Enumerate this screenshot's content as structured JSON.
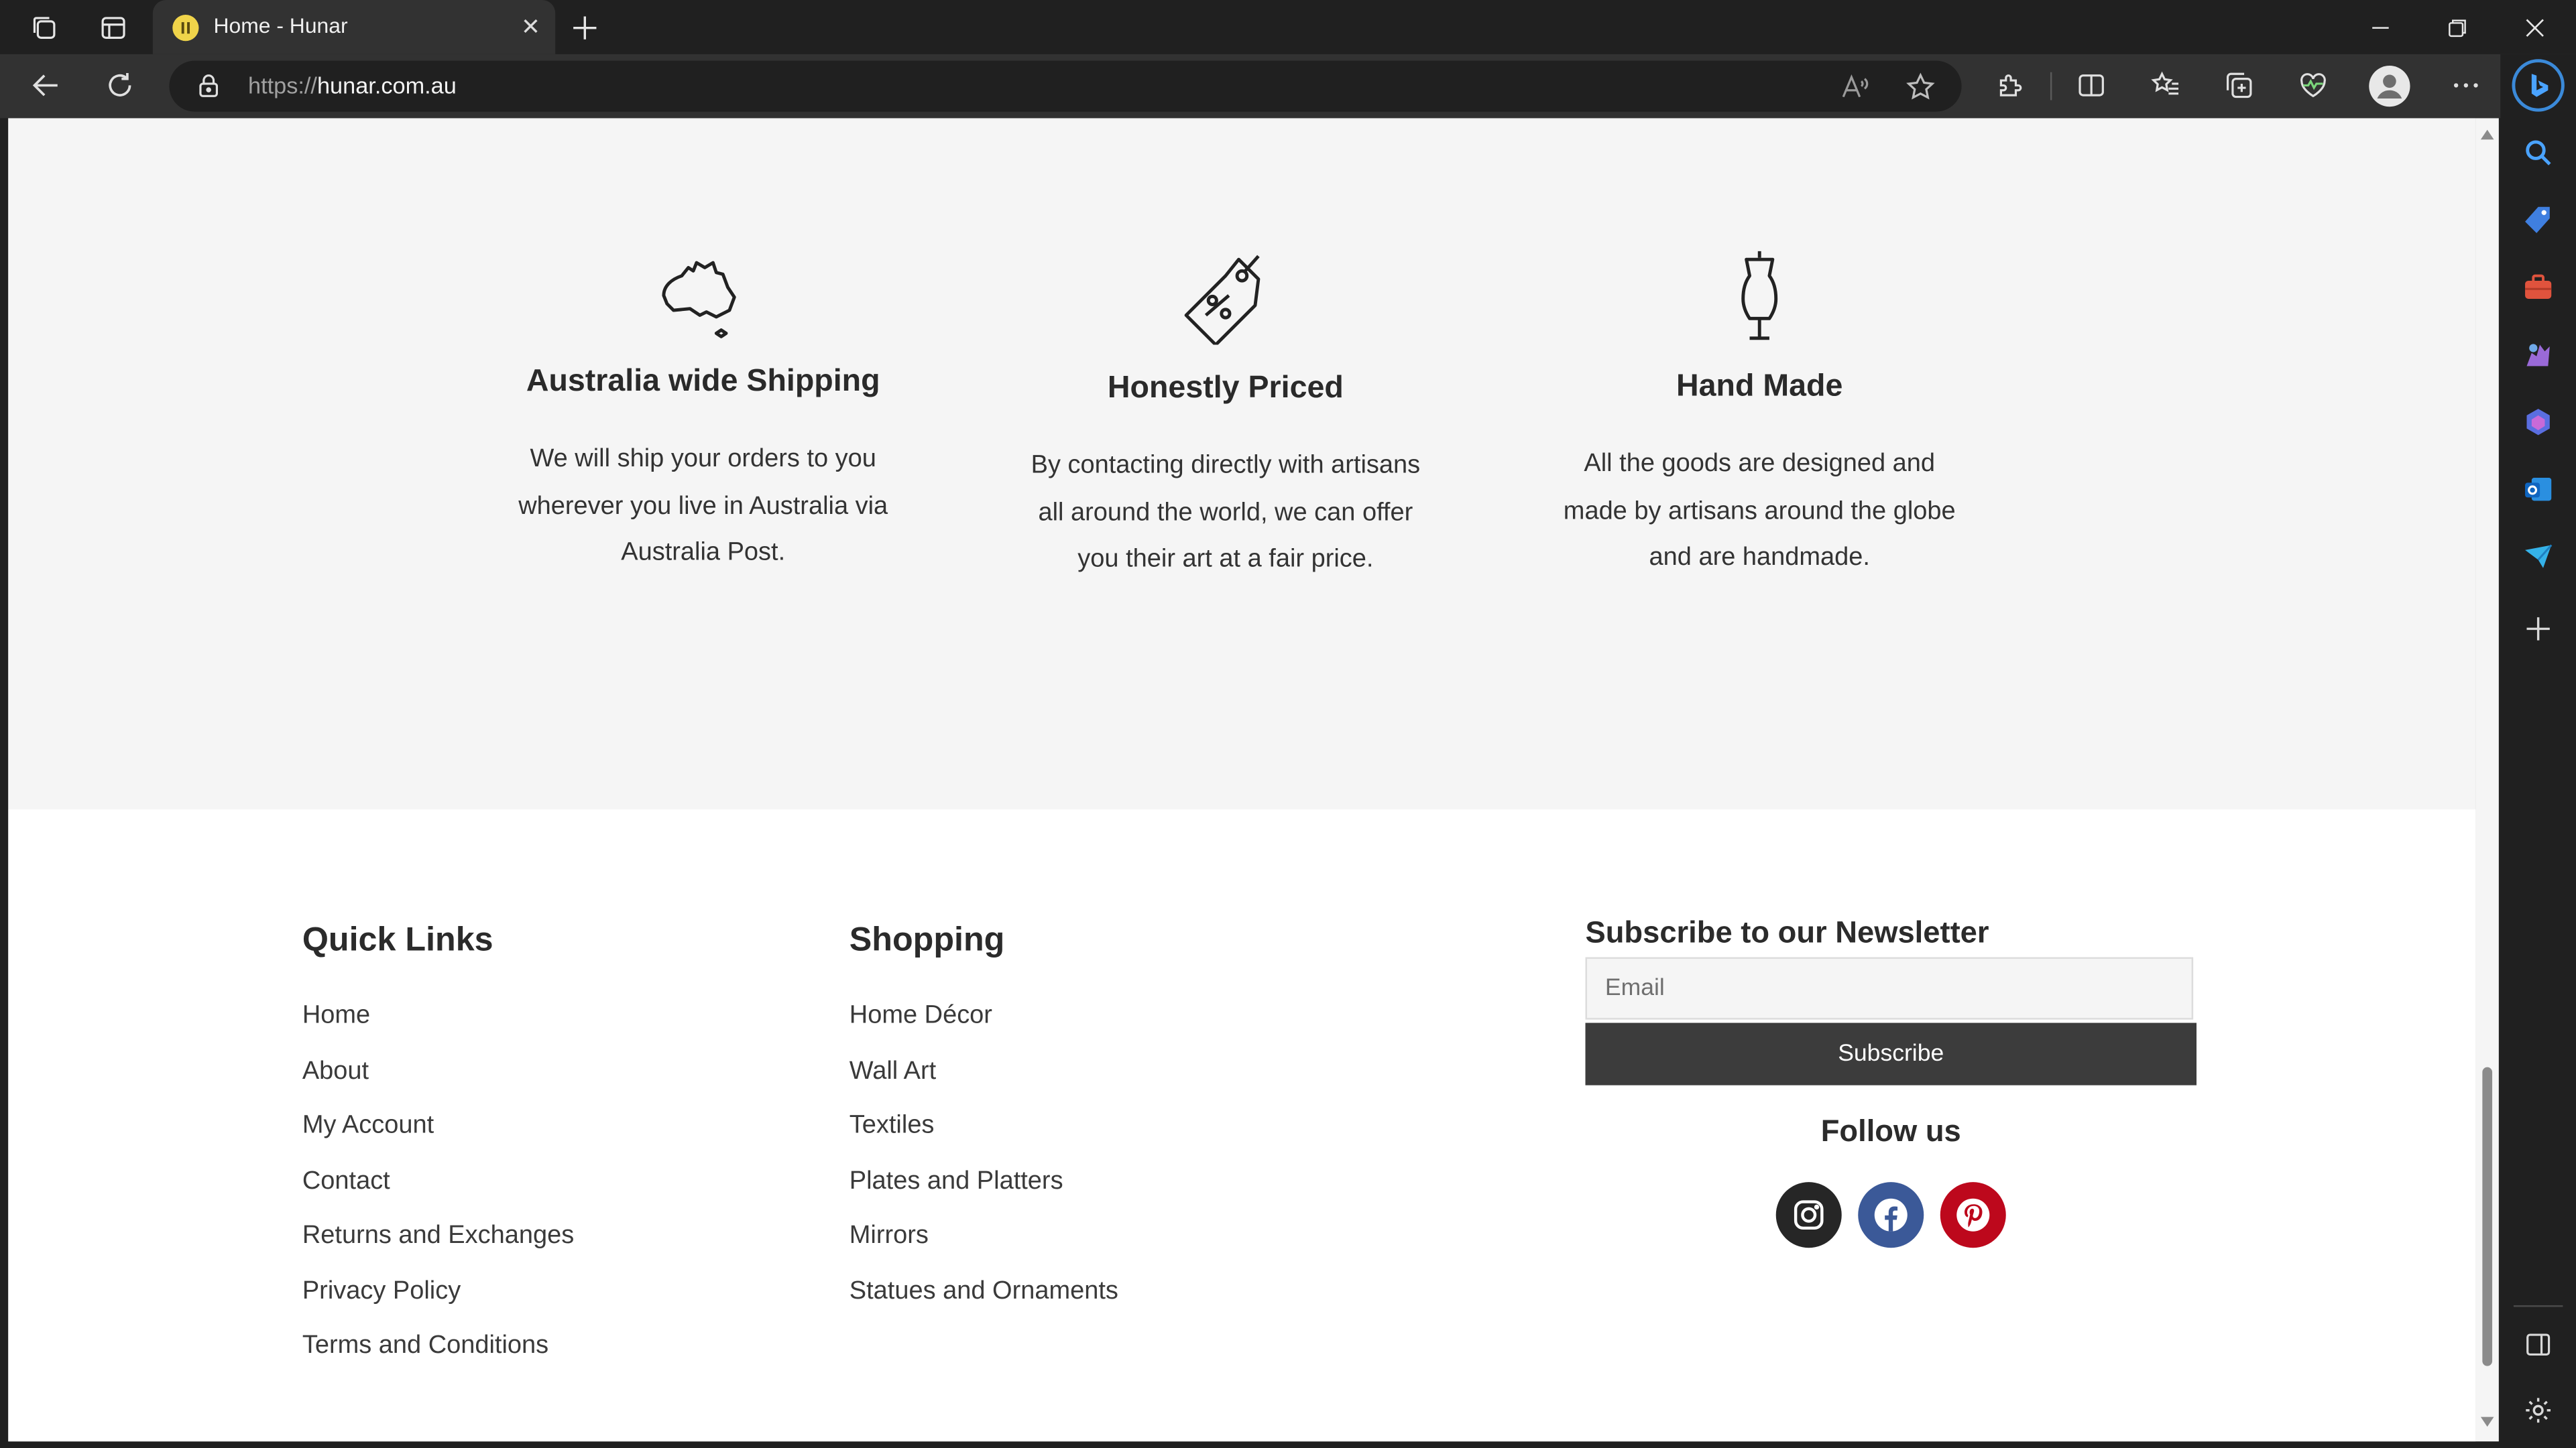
{
  "browser": {
    "tab_title": "Home - Hunar",
    "url_protocol": "https://",
    "url_host": "hunar.com.au"
  },
  "icons": {
    "workspaces": "workspaces-icon",
    "tab_actions": "tab-actions-icon",
    "back": "back-arrow-icon",
    "refresh": "refresh-icon",
    "lock": "lock-icon",
    "read_aloud": "read-aloud-icon",
    "favorite": "star-icon",
    "extensions": "puzzle-icon",
    "split_screen": "split-screen-icon",
    "favorites": "favorites-list-icon",
    "collections": "collections-icon",
    "performance": "heartbeat-icon",
    "profile": "profile-icon",
    "more": "more-icon",
    "copilot": "bing-icon"
  },
  "features": [
    {
      "icon": "australia-map-icon",
      "title": "Australia wide Shipping",
      "text": "We will ship your orders to you wherever you live in Australia via Australia Post."
    },
    {
      "icon": "price-tag-icon",
      "title": "Honestly Priced",
      "text": "By contacting directly with artisans all around the world, we can offer you their art at a fair price."
    },
    {
      "icon": "dress-form-icon",
      "title": "Hand Made",
      "text": "All the goods are designed and made by artisans around the globe and are handmade."
    }
  ],
  "footer": {
    "quick_links_title": "Quick Links",
    "quick_links": [
      "Home",
      "About",
      "My Account",
      "Contact",
      "Returns and Exchanges",
      "Privacy Policy",
      "Terms and Conditions"
    ],
    "shopping_title": "Shopping",
    "shopping_links": [
      "Home Décor",
      "Wall Art",
      "Textiles",
      "Plates and Platters",
      "Mirrors",
      "Statues and Ornaments"
    ],
    "newsletter_title": "Subscribe to our Newsletter",
    "email_placeholder": "Email",
    "subscribe_label": "Subscribe",
    "follow_title": "Follow us",
    "social": [
      {
        "name": "instagram",
        "color": "#262626"
      },
      {
        "name": "facebook",
        "color": "#3b5998"
      },
      {
        "name": "pinterest",
        "color": "#bd081c"
      }
    ]
  },
  "colors": {
    "browser_chrome": "#202020",
    "tab_active": "#323232",
    "page_bg": "#f5f5f5",
    "footer_bg": "#ffffff",
    "subscribe_button": "#3c3c3c"
  }
}
